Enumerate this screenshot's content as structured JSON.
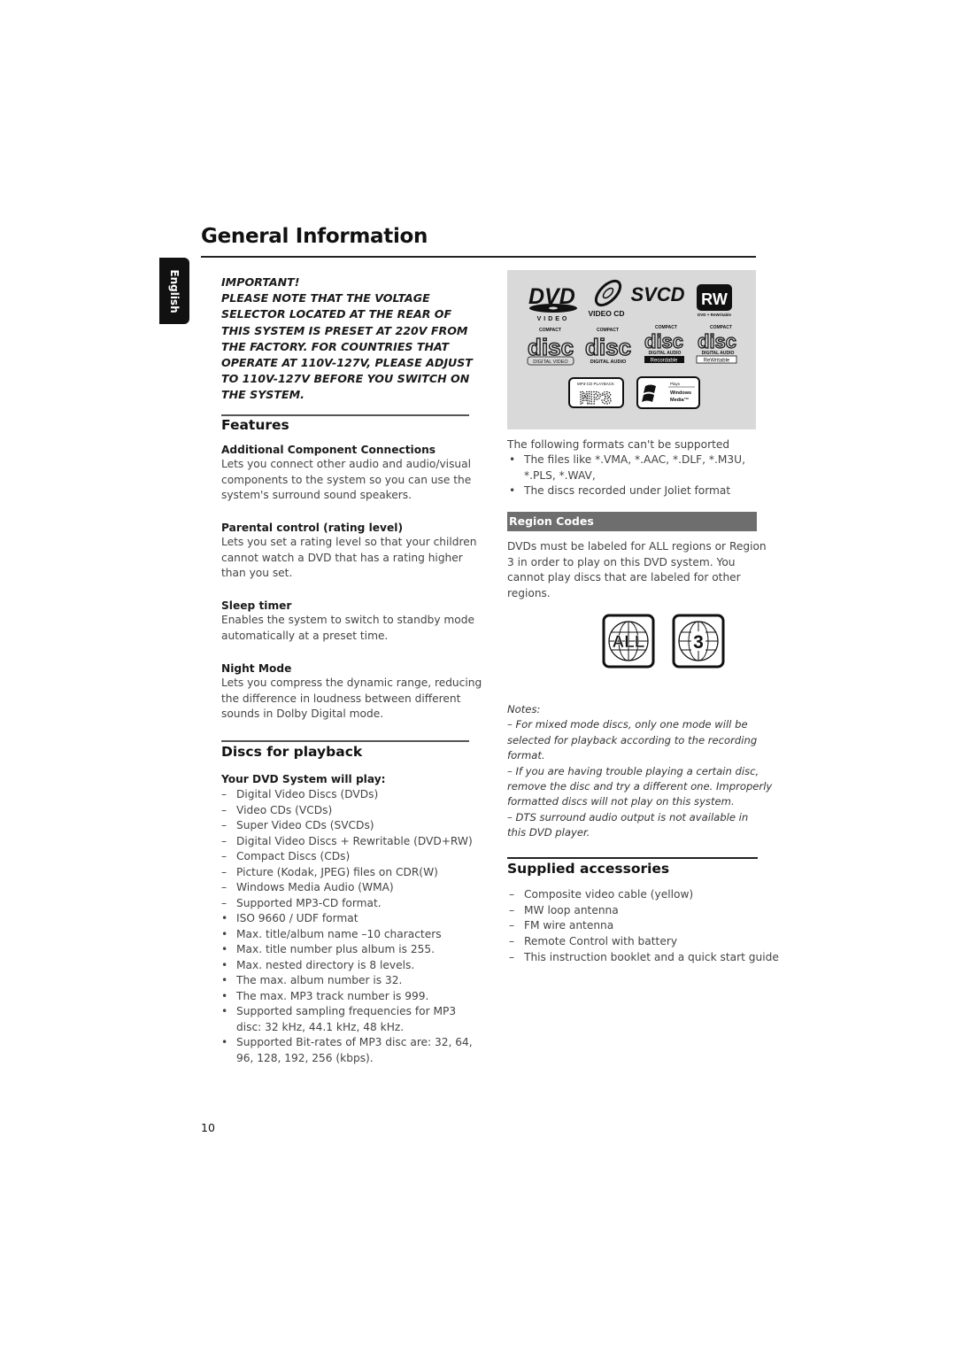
{
  "page": {
    "title": "General Information",
    "language_tab": "English",
    "page_number": "10"
  },
  "important": {
    "lines": [
      "IMPORTANT!",
      "PLEASE NOTE THAT THE VOLTAGE",
      "SELECTOR LOCATED AT THE REAR OF",
      "THIS SYSTEM IS PRESET AT 220V FROM",
      "THE FACTORY. FOR COUNTRIES THAT",
      "OPERATE AT 110V-127V, PLEASE ADJUST",
      "TO 110V-127V BEFORE YOU SWITCH ON",
      "THE SYSTEM."
    ]
  },
  "features": {
    "heading": "Features",
    "items": [
      {
        "title": "Additional Component Connections",
        "lines": [
          "Lets you connect other audio and audio/visual",
          "components to the system so you can use the",
          "system's surround sound speakers."
        ]
      },
      {
        "title": "Parental control (rating level)",
        "lines": [
          "Lets you set a rating level so that your children",
          "cannot watch a DVD that has a rating higher",
          "than you set."
        ]
      },
      {
        "title": "Sleep timer",
        "lines": [
          "Enables the system to switch to standby mode",
          "automatically at a preset time."
        ]
      },
      {
        "title": "Night Mode",
        "lines": [
          "Lets you compress the dynamic range, reducing",
          "the difference in loudness between different",
          "sounds in Dolby Digital mode."
        ]
      }
    ]
  },
  "discs": {
    "heading": "Discs for playback",
    "subheading": "Your DVD System will play:",
    "items": [
      {
        "mark": "–",
        "lines": [
          "Digital Video Discs (DVDs)"
        ]
      },
      {
        "mark": "–",
        "lines": [
          "Video CDs (VCDs)"
        ]
      },
      {
        "mark": "–",
        "lines": [
          "Super Video CDs (SVCDs)"
        ]
      },
      {
        "mark": "–",
        "lines": [
          "Digital Video Discs + Rewritable (DVD+RW)"
        ]
      },
      {
        "mark": "–",
        "lines": [
          "Compact Discs (CDs)"
        ]
      },
      {
        "mark": "–",
        "lines": [
          "Picture (Kodak, JPEG) files on CDR(W)"
        ]
      },
      {
        "mark": "–",
        "lines": [
          "Windows Media Audio (WMA)"
        ]
      },
      {
        "mark": "–",
        "lines": [
          "Supported MP3-CD format."
        ]
      },
      {
        "mark": "•",
        "lines": [
          "ISO 9660 / UDF format"
        ]
      },
      {
        "mark": "•",
        "lines": [
          "Max. title/album name –10 characters"
        ]
      },
      {
        "mark": "•",
        "lines": [
          "Max. title number plus album is 255."
        ]
      },
      {
        "mark": "•",
        "lines": [
          "Max. nested directory is 8 levels."
        ]
      },
      {
        "mark": "•",
        "lines": [
          "The max. album number is 32."
        ]
      },
      {
        "mark": "•",
        "lines": [
          "The max. MP3 track number is 999."
        ]
      },
      {
        "mark": "•",
        "lines": [
          "Supported sampling frequencies for MP3",
          "disc:  32 kHz, 44.1 kHz, 48 kHz."
        ]
      },
      {
        "mark": "•",
        "lines": [
          "Supported Bit-rates of MP3 disc are: 32, 64,",
          "96, 128, 192, 256 (kbps)."
        ]
      }
    ]
  },
  "logos": {
    "dvd_video": {
      "main": "DVD",
      "sub": "VIDEO"
    },
    "video_cd": {
      "sub": "VIDEO CD"
    },
    "svcd": {
      "main": "SVCD"
    },
    "rw": {
      "main": "RW",
      "sub": "DVD + ReWritable"
    },
    "cd_logos": [
      {
        "top": "COMPACT",
        "main": "disc",
        "sub": "DIGITAL VIDEO"
      },
      {
        "top": "COMPACT",
        "main": "disc",
        "sub": "DIGITAL AUDIO"
      },
      {
        "top": "COMPACT",
        "main": "disc",
        "sub": "DIGITAL AUDIO",
        "badge": "Recordable"
      },
      {
        "top": "COMPACT",
        "main": "disc",
        "sub": "DIGITAL AUDIO",
        "badge": "ReWritable"
      }
    ],
    "mp3": {
      "top": "MP3-CD PLAYBACK",
      "main": "MP3"
    },
    "windows_media": {
      "line1": "Plays",
      "line2": "Windows",
      "line3": "Media™"
    }
  },
  "unsupported": {
    "intro": "The following formats can't be supported",
    "items": [
      {
        "mark": "•",
        "lines": [
          "The files like *.VMA, *.AAC, *.DLF, *.M3U,",
          "*.PLS, *.WAV,"
        ]
      },
      {
        "mark": "•",
        "lines": [
          "The discs recorded under Joliet format"
        ]
      }
    ]
  },
  "region": {
    "heading": "Region Codes",
    "lines": [
      "DVDs must be labeled for ALL regions or Region",
      "3 in order to play on this DVD system. You",
      "cannot play discs that are labeled for other",
      "regions."
    ],
    "icons": [
      {
        "label": "ALL"
      },
      {
        "label": "3"
      }
    ]
  },
  "notes": {
    "title": "Notes:",
    "lines": [
      "–  For mixed mode discs, only one mode will be",
      "selected for playback according to the recording",
      "format.",
      "–  If you are having trouble playing a certain disc,",
      "remove the disc and try a different one. Improperly",
      "formatted discs will not play on this system.",
      "–  DTS surround audio output is not available in",
      "this DVD player."
    ]
  },
  "accessories": {
    "heading": "Supplied accessories",
    "items": [
      {
        "mark": "–",
        "lines": [
          "Composite video cable (yellow)"
        ]
      },
      {
        "mark": "–",
        "lines": [
          "MW loop antenna"
        ]
      },
      {
        "mark": "–",
        "lines": [
          "FM wire antenna"
        ]
      },
      {
        "mark": "–",
        "lines": [
          "Remote Control with battery"
        ]
      },
      {
        "mark": "–",
        "lines": [
          "This instruction booklet and a quick start guide"
        ]
      }
    ]
  }
}
